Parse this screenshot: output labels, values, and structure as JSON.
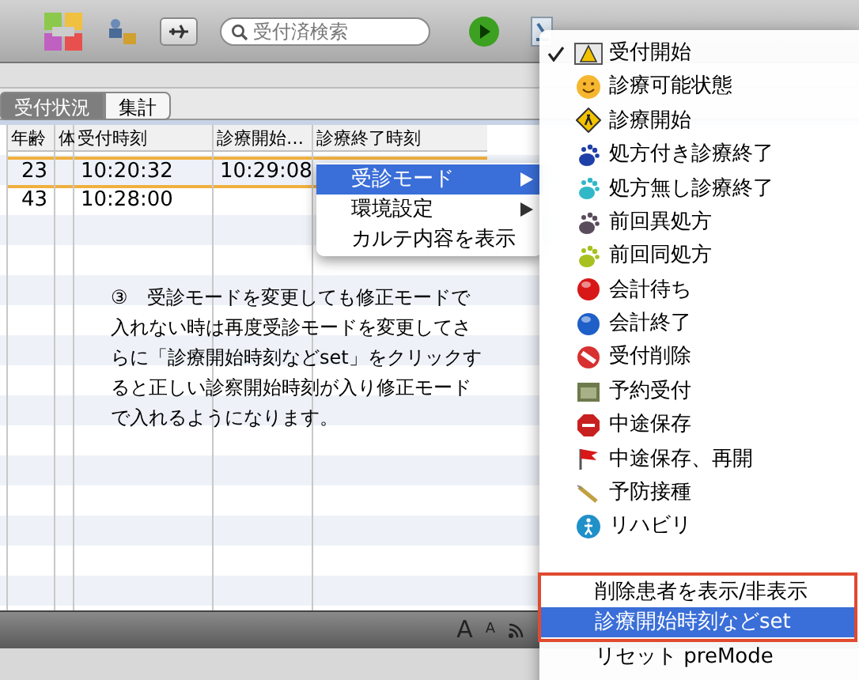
{
  "toolbar": {
    "search": {
      "placeholder": "受付済検索"
    }
  },
  "tabs": [
    {
      "label": "受付状況",
      "selected": true
    },
    {
      "label": "集計",
      "selected": false
    }
  ],
  "table": {
    "columns": [
      "年齢",
      "体",
      "受付時刻",
      "診療開始…",
      "診療終了時刻"
    ],
    "rows": [
      {
        "age": "23",
        "reception_time": "10:20:32",
        "start_time": "10:29:08",
        "selected": true
      },
      {
        "age": "43",
        "reception_time": "10:28:00",
        "selected": false
      }
    ]
  },
  "note": "③　受診モードを変更しても修正モードで入れない時は再度受診モードを変更してさらに「診療開始時刻などset」をクリックすると正しい診察開始時刻が入り修正モードで入れるようになります。",
  "context_menu": {
    "items": [
      {
        "label": "受診モード",
        "submenu": true,
        "selected": true
      },
      {
        "label": "環境設定",
        "submenu": true,
        "selected": false
      },
      {
        "label": "カルテ内容を表示",
        "submenu": false,
        "selected": false
      }
    ]
  },
  "status_menu": {
    "items": [
      {
        "kind": "status",
        "label": "受付開始",
        "checked": true,
        "selected": false
      },
      {
        "kind": "status",
        "label": "診療可能状態",
        "checked": false,
        "selected": false
      },
      {
        "kind": "status",
        "label": "診療開始",
        "checked": false,
        "selected": false
      },
      {
        "kind": "status",
        "label": "処方付き診療終了",
        "checked": false,
        "selected": false
      },
      {
        "kind": "status",
        "label": "処方無し診療終了",
        "checked": false,
        "selected": false
      },
      {
        "kind": "status",
        "label": "前回異処方",
        "checked": false,
        "selected": false
      },
      {
        "kind": "status",
        "label": "前回同処方",
        "checked": false,
        "selected": false
      },
      {
        "kind": "status",
        "label": "会計待ち",
        "checked": false,
        "selected": false
      },
      {
        "kind": "status",
        "label": "会計終了",
        "checked": false,
        "selected": false
      },
      {
        "kind": "status",
        "label": "受付削除",
        "checked": false,
        "selected": false
      },
      {
        "kind": "status",
        "label": "予約受付",
        "checked": false,
        "selected": false
      },
      {
        "kind": "status",
        "label": "中途保存",
        "checked": false,
        "selected": false
      },
      {
        "kind": "status",
        "label": "中途保存、再開",
        "checked": false,
        "selected": false
      },
      {
        "kind": "status",
        "label": "予防接種",
        "checked": false,
        "selected": false
      },
      {
        "kind": "status",
        "label": "リハビリ",
        "checked": false,
        "selected": false
      },
      {
        "kind": "separator"
      },
      {
        "kind": "command",
        "label": "削除患者を表示/非表示",
        "selected": false
      },
      {
        "kind": "command",
        "label": "診療開始時刻などset",
        "selected": true
      },
      {
        "kind": "command",
        "label": "リセット preMode",
        "selected": false
      }
    ]
  },
  "status_bar": {
    "buttons": [
      "A",
      "A"
    ]
  }
}
